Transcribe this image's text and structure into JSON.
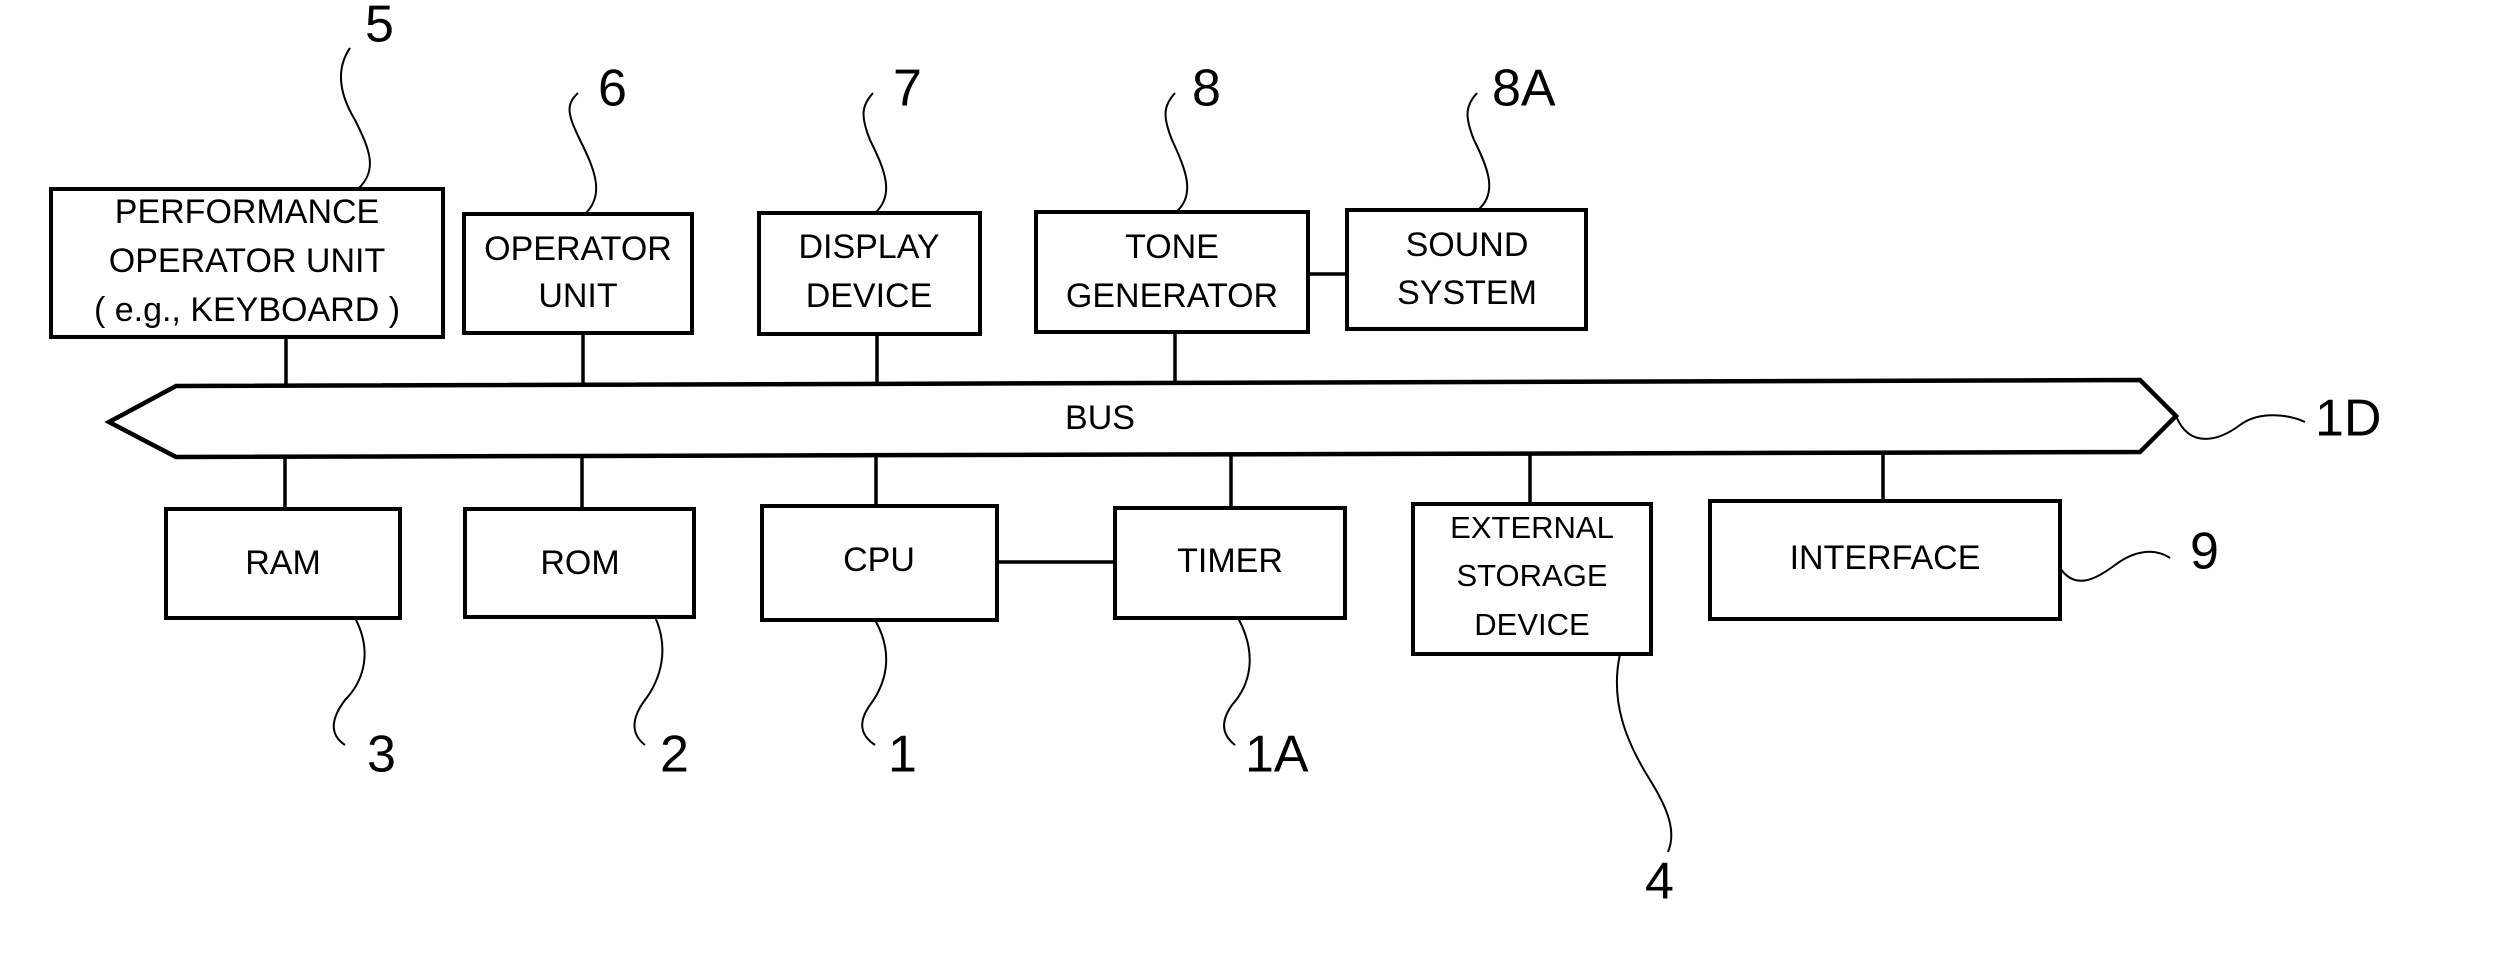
{
  "diagram": {
    "bus": {
      "label": "BUS",
      "ref": "1D"
    },
    "blocks": {
      "performance": {
        "lines": [
          "PERFORMANCE",
          "OPERATOR UNIT",
          "( e.g., KEYBOARD )"
        ],
        "ref": "5"
      },
      "operator": {
        "lines": [
          "OPERATOR",
          "UNIT"
        ],
        "ref": "6"
      },
      "display": {
        "lines": [
          "DISPLAY",
          "DEVICE"
        ],
        "ref": "7"
      },
      "tone": {
        "lines": [
          "TONE",
          "GENERATOR"
        ],
        "ref": "8"
      },
      "sound": {
        "lines": [
          "SOUND",
          "SYSTEM"
        ],
        "ref": "8A"
      },
      "ram": {
        "lines": [
          "RAM"
        ],
        "ref": "3"
      },
      "rom": {
        "lines": [
          "ROM"
        ],
        "ref": "2"
      },
      "cpu": {
        "lines": [
          "CPU"
        ],
        "ref": "1"
      },
      "timer": {
        "lines": [
          "TIMER"
        ],
        "ref": "1A"
      },
      "storage": {
        "lines": [
          "EXTERNAL",
          "STORAGE",
          "DEVICE"
        ],
        "ref": "4"
      },
      "interface": {
        "lines": [
          "INTERFACE"
        ],
        "ref": "9"
      }
    }
  }
}
